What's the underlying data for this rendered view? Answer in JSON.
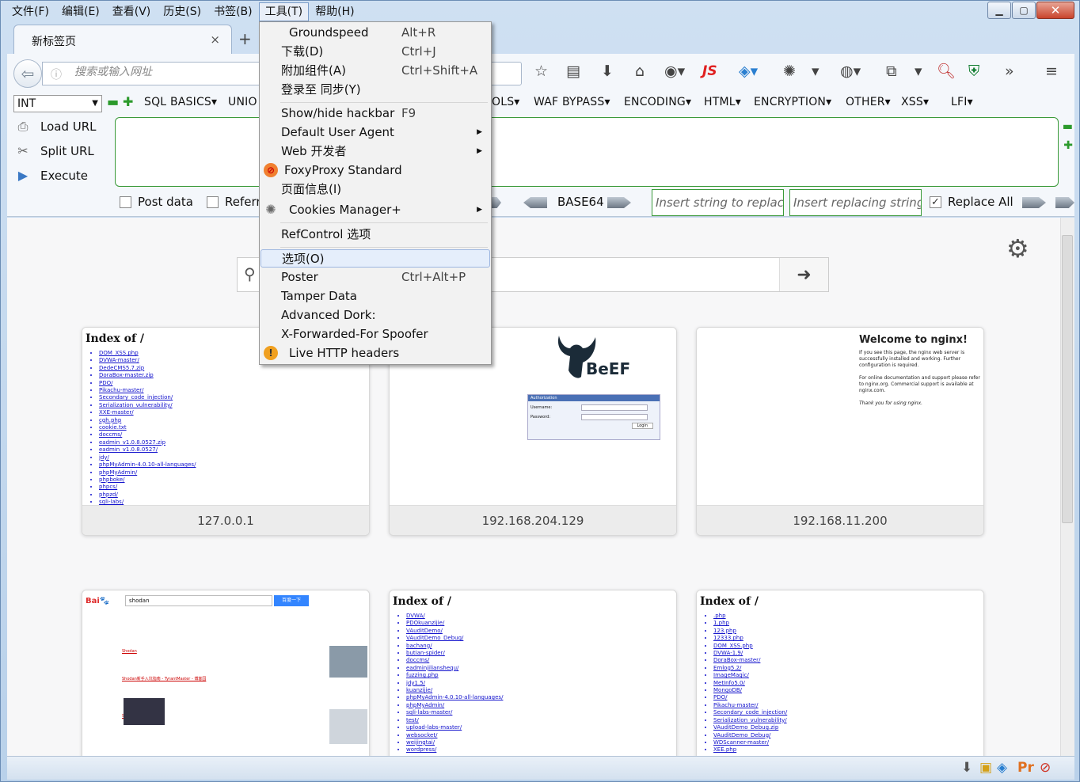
{
  "menubar": {
    "items": [
      "文件(F)",
      "编辑(E)",
      "查看(V)",
      "历史(S)",
      "书签(B)",
      "工具(T)",
      "帮助(H)"
    ]
  },
  "tab": {
    "title": "新标签页",
    "close": "×"
  },
  "newtab": "+",
  "urlbar": {
    "placeholder": "搜索或输入网址"
  },
  "toolbar": {
    "js_label": "JS"
  },
  "hackbar": {
    "select_value": "INT",
    "menus": [
      "SQL BASICS▾",
      "UNIO",
      "OLS▾",
      "WAF BYPASS▾",
      "ENCODING▾",
      "HTML▾",
      "ENCRYPTION▾",
      "OTHER▾",
      "XSS▾",
      "LFI▾"
    ],
    "load_url": "Load URL",
    "split_url": "Split URL",
    "execute": "Execute",
    "post_data": "Post data",
    "referrer": "Referr",
    "base64": "BASE64",
    "insert_replace_placeholder": "Insert string to replace",
    "insert_replacing_placeholder": "Insert replacing string",
    "replace_all": "Replace All"
  },
  "tiles": [
    {
      "label": "127.0.0.1",
      "title": "Index of /",
      "files": [
        "DOM_XSS.php",
        "DVWA-master/",
        "DedeCMS5.7.zip",
        "DoraBox-master.zip",
        "PDO/",
        "Pikachu-master/",
        "Secondary_code_injection/",
        "Serialization_vulnerability/",
        "XXE-master/",
        "cgh.php",
        "cookie.txt",
        "doccms/",
        "eadmin_v1.0.8.0527.zip",
        "eadmin_v1.0.8.0527/",
        "jdy/",
        "phpMyAdmin-4.0.10-all-languages/",
        "phpMyAdmin/",
        "phpboke/",
        "phpcs/",
        "phpzd/",
        "sqli-labs/"
      ]
    },
    {
      "label": "192.168.204.129",
      "logo": "BeEF",
      "auth_title": "Authorization",
      "auth_user": "Username:",
      "auth_pass": "Password:",
      "auth_btn": "Login"
    },
    {
      "label": "192.168.11.200",
      "title": "Welcome to nginx!",
      "p1": "If you see this page, the nginx web server is successfully installed and working. Further configuration is required.",
      "p2": "For online documentation and support please refer to nginx.org. Commercial support is available at nginx.com.",
      "p3": "Thank you for using nginx."
    },
    {
      "label": "",
      "query": "shodan",
      "search_btn": "百度一下",
      "results": [
        "Shodan",
        "Shodan新手入坑指南 - TyrantMaster - 博客园",
        "Shodan_百度百科"
      ]
    },
    {
      "label": "",
      "title": "Index of /",
      "files": [
        "DVWA/",
        "PDOkuanzijie/",
        "VAuditDemo/",
        "VAuditDemo_Debug/",
        "bachang/",
        "butian-spider/",
        "doccms/",
        "eadminjilianshequ/",
        "fuzzing.php",
        "jdy1.5/",
        "kuanzijie/",
        "phpMyAdmin-4.0.10-all-languages/",
        "phpMyAdmin/",
        "sqli-labs-master/",
        "test/",
        "upload-labs-master/",
        "websocket/",
        "weijingtai/",
        "wordpress/"
      ]
    },
    {
      "label": "",
      "title": "Index of /",
      "files": [
        ".php",
        "1.php",
        "123.php",
        "12333.php",
        "DOM_XSS.php",
        "DVWA-1.9/",
        "DoraBox-master/",
        "Emlog5.2/",
        "ImageMagic/",
        "MetInfo5.0/",
        "MongoDB/",
        "PDO/",
        "Pikachu-master/",
        "Secondary_code_injection/",
        "Serialization_vulnerability/",
        "VAuditDemo_Debug.zip",
        "VAuditDemo_Debug/",
        "WDScanner-master/",
        "XEE.php"
      ]
    }
  ],
  "tools_menu": {
    "items": [
      {
        "label": "Groundspeed",
        "shortcut": "Alt+R"
      },
      {
        "label": "下载(D)",
        "shortcut": "Ctrl+J"
      },
      {
        "label": "附加组件(A)",
        "shortcut": "Ctrl+Shift+A"
      },
      {
        "label": "登录至 同步(Y)",
        "shortcut": ""
      },
      {
        "label": "Show/hide hackbar",
        "shortcut": "F9"
      },
      {
        "label": "Default User Agent",
        "shortcut": ""
      },
      {
        "label": "Web 开发者",
        "shortcut": ""
      },
      {
        "label": "FoxyProxy Standard",
        "shortcut": ""
      },
      {
        "label": "页面信息(I)",
        "shortcut": ""
      },
      {
        "label": "Cookies Manager+",
        "shortcut": ""
      },
      {
        "label": "RefControl 选项",
        "shortcut": ""
      },
      {
        "label": "选项(O)",
        "shortcut": ""
      },
      {
        "label": "Poster",
        "shortcut": "Ctrl+Alt+P"
      },
      {
        "label": "Tamper Data",
        "shortcut": ""
      },
      {
        "label": "Advanced Dork:",
        "shortcut": ""
      },
      {
        "label": "X-Forwarded-For Spoofer",
        "shortcut": ""
      },
      {
        "label": "Live HTTP headers",
        "shortcut": ""
      }
    ]
  }
}
